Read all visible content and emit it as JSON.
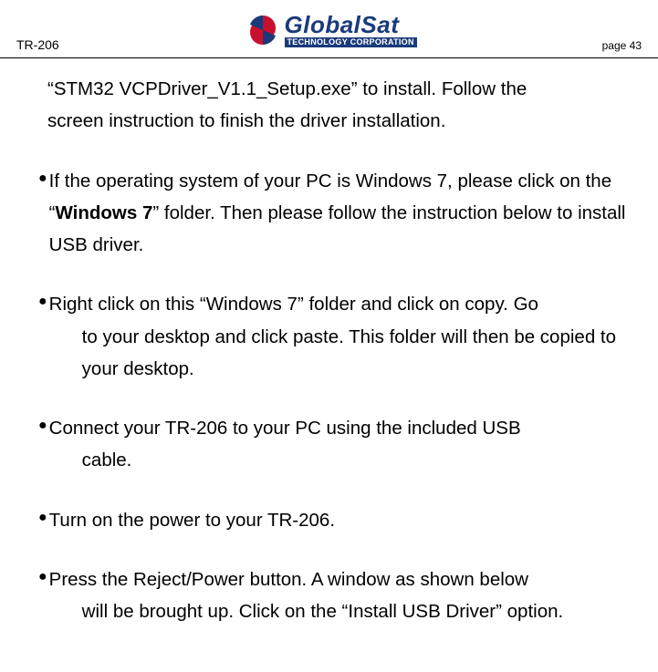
{
  "header": {
    "model": "TR-206",
    "page_label": "page 43",
    "logo_name": "GlobalSat",
    "logo_sub": "TECHNOLOGY CORPORATION"
  },
  "body": {
    "cont_line1": "“STM32 VCPDriver_V1.1_Setup.exe” to install. Follow the",
    "cont_line2": "screen instruction to finish the driver installation.",
    "b1_pre": "If the operating system of your PC is Windows 7, please click on the “",
    "b1_bold": "Windows 7",
    "b1_post": "” folder. Then please follow the instruction below to install USB driver.",
    "b2_line1": "Right click on this “Windows 7” folder and click on copy. Go",
    "b2_rest": "to your desktop and click paste. This folder will then be copied to your desktop.",
    "b3_line1": "Connect your TR-206 to your PC using the included USB",
    "b3_rest": "cable.",
    "b4": "Turn on the power to your TR-206.",
    "b5_line1": "Press the Reject/Power button. A window as shown below",
    "b5_rest": "will be brought up. Click on the “Install USB Driver” option."
  }
}
